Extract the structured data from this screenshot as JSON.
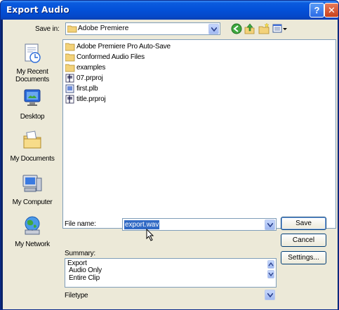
{
  "window": {
    "title": "Export Audio",
    "help_glyph": "?",
    "close_glyph": "✕"
  },
  "save_in": {
    "label": "Save in:",
    "value": "Adobe Premiere",
    "folder_icon": "folder-icon",
    "tools": [
      "back-icon",
      "up-folder-icon",
      "new-folder-icon",
      "view-menu-icon"
    ]
  },
  "places": [
    {
      "label": "My Recent Documents",
      "icon": "recent-documents-icon"
    },
    {
      "label": "Desktop",
      "icon": "desktop-icon"
    },
    {
      "label": "My Documents",
      "icon": "my-documents-icon"
    },
    {
      "label": "My Computer",
      "icon": "my-computer-icon"
    },
    {
      "label": "My Network",
      "icon": "my-network-icon"
    }
  ],
  "files": [
    {
      "name": "Adobe Premiere Pro Auto-Save",
      "icon": "folder-icon"
    },
    {
      "name": "Conformed Audio Files",
      "icon": "folder-icon"
    },
    {
      "name": "examples",
      "icon": "folder-icon"
    },
    {
      "name": "07.prproj",
      "icon": "premiere-project-icon"
    },
    {
      "name": "first.plb",
      "icon": "bin-file-icon"
    },
    {
      "name": "title.prproj",
      "icon": "premiere-project-icon"
    }
  ],
  "file_name": {
    "label": "File name:",
    "value": "export.wav"
  },
  "buttons": {
    "save": "Save",
    "cancel": "Cancel",
    "settings": "Settings..."
  },
  "summary": {
    "label": "Summary:",
    "lines": [
      "Export",
      "Audio Only",
      "Entire Clip"
    ]
  },
  "file_type": {
    "label": "Filetype"
  },
  "colors": {
    "title_bar": "#0350d8",
    "selection": "#316ac5",
    "dialog_bg": "#ece9d8"
  }
}
